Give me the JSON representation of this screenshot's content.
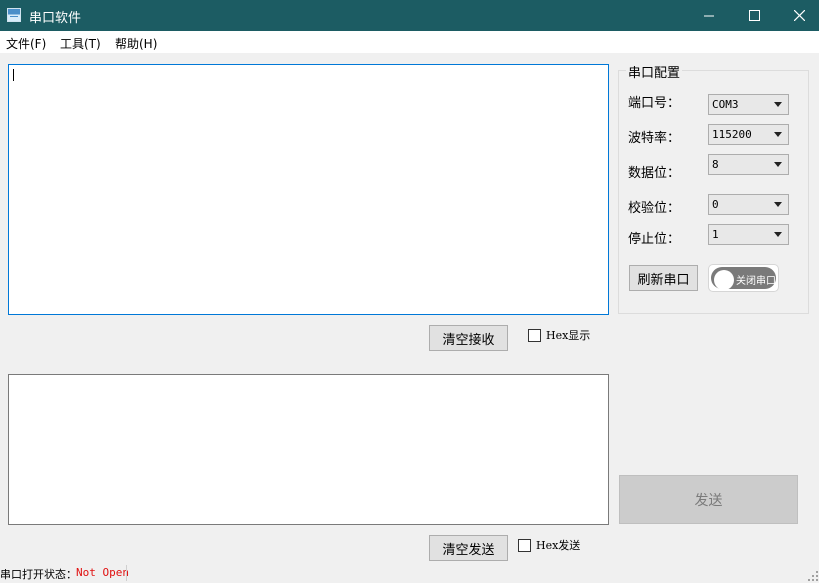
{
  "window": {
    "title": "串口软件"
  },
  "menu": [
    {
      "label": "文件(F)"
    },
    {
      "label": "工具(T)"
    },
    {
      "label": "帮助(H)"
    }
  ],
  "receive": {
    "text": "",
    "clear_label": "清空接收",
    "hex_label": "Hex显示",
    "hex_checked": false
  },
  "send": {
    "text": "",
    "clear_label": "清空发送",
    "hex_label": "Hex发送",
    "hex_checked": false,
    "send_label": "发送"
  },
  "config": {
    "group_title": "串口配置",
    "rows": [
      {
        "label": "端口号：",
        "value": "COM3"
      },
      {
        "label": "波特率：",
        "value": "115200"
      },
      {
        "label": "数据位：",
        "value": "8"
      },
      {
        "label": "校验位：",
        "value": "0"
      },
      {
        "label": "停止位：",
        "value": "1"
      }
    ],
    "refresh_label": "刷新串口",
    "toggle_label": "关闭串口",
    "toggle_on": false
  },
  "status": {
    "label": "串口打开状态：",
    "value": "Not Open"
  },
  "colors": {
    "titlebar": "#1c5c63",
    "status_value": "#e01010",
    "toggle_track": "#7a7a7a",
    "focus_border": "#0078d7"
  }
}
